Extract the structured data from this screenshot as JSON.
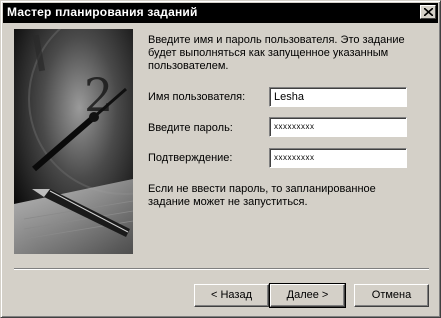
{
  "window": {
    "title": "Мастер планирования заданий"
  },
  "intro_text": "Введите имя и пароль пользователя.  Это задание будет выполняться как запущенное указанным пользователем.",
  "form": {
    "username_label": "Имя пользователя:",
    "username_value": "Lesha",
    "password_label": "Введите пароль:",
    "password_value": "xxxxxxxxx",
    "confirm_label": "Подтверждение:",
    "confirm_value": "xxxxxxxxx"
  },
  "warning_text": "Если не ввести пароль, то запланированное задание может не запуститься.",
  "buttons": {
    "back": "< Назад",
    "next": "Далее >",
    "cancel": "Отмена"
  },
  "icons": {
    "close": "close-icon",
    "illustration": "clock-and-pen-illustration"
  }
}
